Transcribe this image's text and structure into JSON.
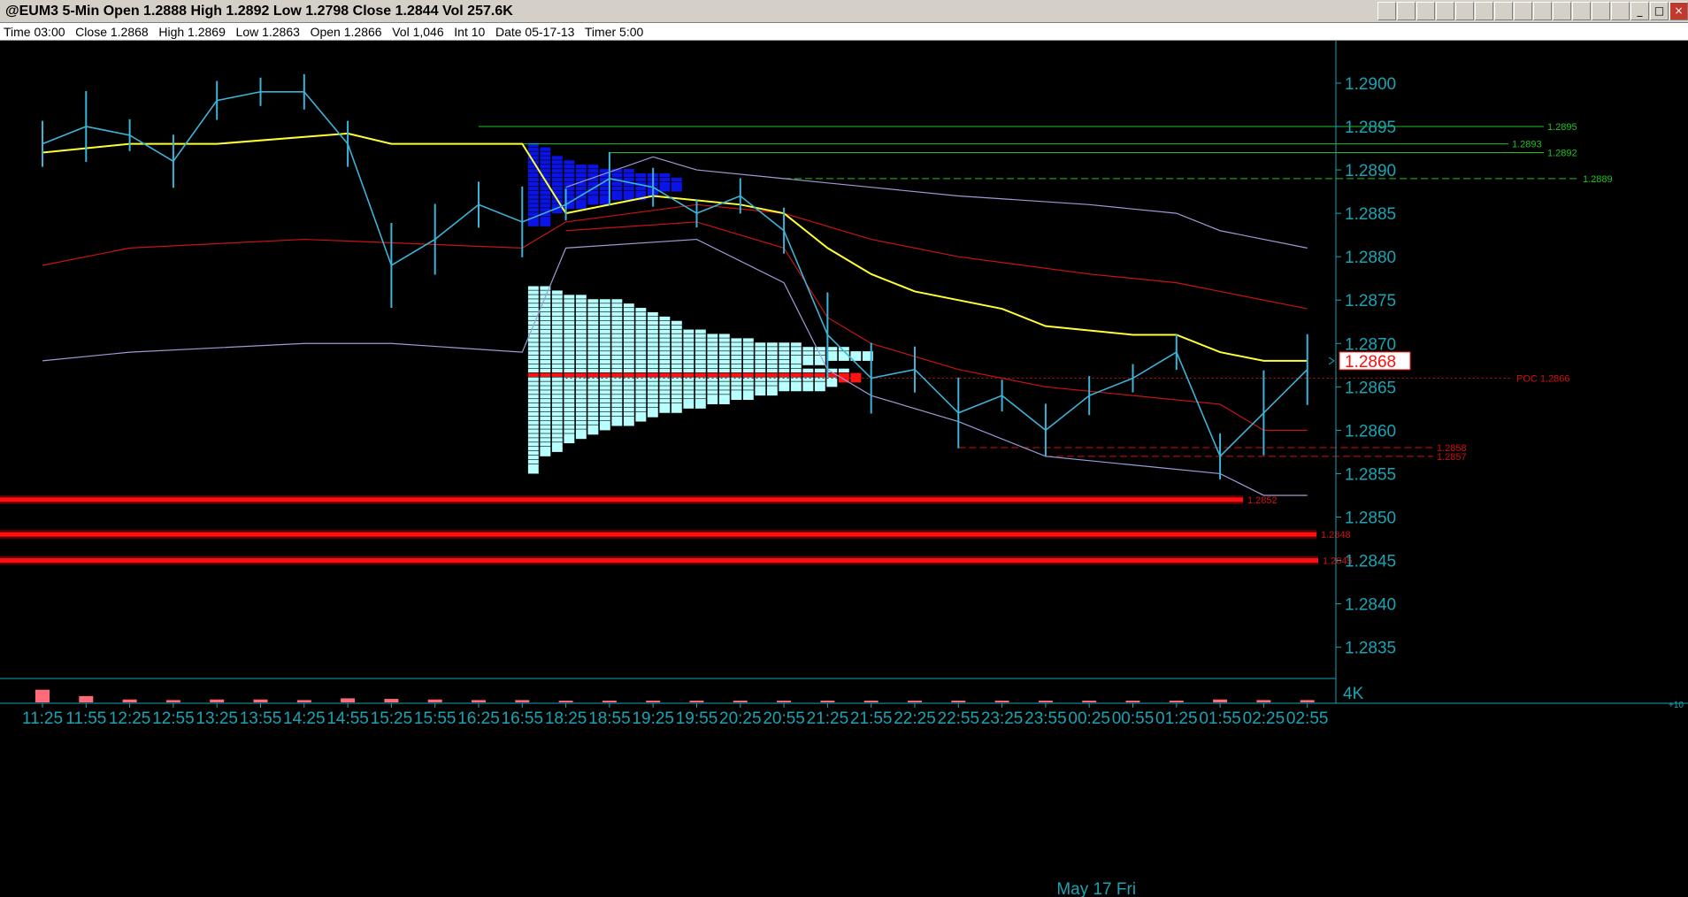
{
  "window": {
    "title": "@EUM3 5-Min Open 1.2888 High 1.2892 Low 1.2798 Close 1.2844 Vol 257.6K",
    "toolbar_icons": [
      "chart-icon",
      "draw-icon",
      "indicator-icon",
      "pencil-icon",
      "bar-icon",
      "color-icon",
      "clock-icon",
      "cursor-icon",
      "grid-icon",
      "line-icon",
      "arrow-down-icon",
      "trash-icon",
      "tools-icon",
      "minimize-icon",
      "maximize-icon",
      "close-icon"
    ]
  },
  "infobar": {
    "text": "Time 03:00   Close 1.2868   High 1.2869   Low 1.2863   Open 1.2866   Vol 1,046   Int 10   Date 05-17-13   Timer 5:00"
  },
  "chart_data": {
    "type": "line",
    "title": "@EUM3 5-Min",
    "y_ticks": [
      "1.2900",
      "1.2895",
      "1.2890",
      "1.2885",
      "1.2880",
      "1.2875",
      "1.2870",
      "1.2865",
      "1.2860",
      "1.2855",
      "1.2850",
      "1.2845",
      "1.2840",
      "1.2835"
    ],
    "ylim": [
      1.28315,
      1.29055
    ],
    "x_ticks": [
      "11:25",
      "11:55",
      "12:25",
      "12:55",
      "13:25",
      "13:55",
      "14:25",
      "14:55",
      "15:25",
      "15:55",
      "16:25",
      "16:55",
      "18:25",
      "18:55",
      "19:25",
      "19:55",
      "20:25",
      "20:55",
      "21:25",
      "21:55",
      "22:25",
      "22:55",
      "23:25",
      "23:55",
      "00:25",
      "00:55",
      "01:25",
      "01:55",
      "02:25",
      "02:55"
    ],
    "date_label": "May 17 Fri",
    "last_price": "1.2868",
    "volume_label": "4K",
    "volume_sublabel": "+10",
    "level_lines": [
      {
        "label": "1.2895",
        "value": 1.2895,
        "from": "16:25",
        "color": "#21c021",
        "style": "solid"
      },
      {
        "label": "1.2893",
        "value": 1.2893,
        "from": "16:55",
        "color": "#21c021",
        "style": "solid"
      },
      {
        "label": "1.2892",
        "value": 1.2892,
        "from": "18:55",
        "color": "#21c021",
        "style": "solid"
      },
      {
        "label": "1.2889",
        "value": 1.2889,
        "from": "20:55",
        "color": "#21c021",
        "style": "dashed"
      },
      {
        "label": "1.2858",
        "value": 1.2858,
        "from": "22:55",
        "color": "#d01010",
        "style": "dashed"
      },
      {
        "label": "1.2857",
        "value": 1.2857,
        "from": "23:55",
        "color": "#d01010",
        "style": "dashed"
      },
      {
        "label": "POC 1.2866",
        "value": 1.2866,
        "from": "18:25",
        "color": "#d01010",
        "style": "dotted"
      }
    ],
    "support_bands": [
      {
        "label": "1.2852",
        "value": 1.2852
      },
      {
        "label": "1.2848",
        "value": 1.2848
      },
      {
        "label": "1.2845",
        "value": 1.2845
      }
    ],
    "price_series": [
      {
        "t": "11:25",
        "v": 1.2893
      },
      {
        "t": "11:55",
        "v": 1.2895
      },
      {
        "t": "12:25",
        "v": 1.2894
      },
      {
        "t": "12:55",
        "v": 1.2891
      },
      {
        "t": "13:25",
        "v": 1.2898
      },
      {
        "t": "13:55",
        "v": 1.2899
      },
      {
        "t": "14:25",
        "v": 1.2899
      },
      {
        "t": "14:55",
        "v": 1.2893
      },
      {
        "t": "15:25",
        "v": 1.2879
      },
      {
        "t": "15:55",
        "v": 1.2882
      },
      {
        "t": "16:25",
        "v": 1.2886
      },
      {
        "t": "16:55",
        "v": 1.2884
      },
      {
        "t": "18:25",
        "v": 1.2886
      },
      {
        "t": "18:55",
        "v": 1.2889
      },
      {
        "t": "19:25",
        "v": 1.2888
      },
      {
        "t": "19:55",
        "v": 1.2885
      },
      {
        "t": "20:25",
        "v": 1.2887
      },
      {
        "t": "20:55",
        "v": 1.2883
      },
      {
        "t": "21:25",
        "v": 1.2871
      },
      {
        "t": "21:55",
        "v": 1.2866
      },
      {
        "t": "22:25",
        "v": 1.2867
      },
      {
        "t": "22:55",
        "v": 1.2862
      },
      {
        "t": "23:25",
        "v": 1.2864
      },
      {
        "t": "23:55",
        "v": 1.286
      },
      {
        "t": "00:25",
        "v": 1.2864
      },
      {
        "t": "00:55",
        "v": 1.2866
      },
      {
        "t": "01:25",
        "v": 1.2869
      },
      {
        "t": "01:55",
        "v": 1.2857
      },
      {
        "t": "02:25",
        "v": 1.2862
      },
      {
        "t": "02:55",
        "v": 1.2867
      }
    ],
    "vwap_series": [
      {
        "t": "11:25",
        "v": 1.2892
      },
      {
        "t": "12:25",
        "v": 1.2893
      },
      {
        "t": "13:25",
        "v": 1.2893
      },
      {
        "t": "14:55",
        "v": 1.28942
      },
      {
        "t": "15:25",
        "v": 1.2893
      },
      {
        "t": "16:55",
        "v": 1.2893
      },
      {
        "t": "18:25",
        "v": 1.2885
      },
      {
        "t": "19:25",
        "v": 1.2887
      },
      {
        "t": "20:25",
        "v": 1.2886
      },
      {
        "t": "20:55",
        "v": 1.2885
      },
      {
        "t": "21:25",
        "v": 1.2881
      },
      {
        "t": "21:55",
        "v": 1.2878
      },
      {
        "t": "22:25",
        "v": 1.2876
      },
      {
        "t": "23:25",
        "v": 1.2874
      },
      {
        "t": "23:55",
        "v": 1.2872
      },
      {
        "t": "00:55",
        "v": 1.2871
      },
      {
        "t": "01:25",
        "v": 1.2871
      },
      {
        "t": "01:55",
        "v": 1.2869
      },
      {
        "t": "02:25",
        "v": 1.2868
      },
      {
        "t": "02:55",
        "v": 1.2868
      }
    ],
    "upper_band_series": [
      {
        "t": "18:25",
        "v": 1.2888
      },
      {
        "t": "19:25",
        "v": 1.28915
      },
      {
        "t": "19:55",
        "v": 1.289
      },
      {
        "t": "20:55",
        "v": 1.2889
      },
      {
        "t": "21:55",
        "v": 1.2888
      },
      {
        "t": "22:55",
        "v": 1.2887
      },
      {
        "t": "00:25",
        "v": 1.2886
      },
      {
        "t": "01:25",
        "v": 1.2885
      },
      {
        "t": "01:55",
        "v": 1.2883
      },
      {
        "t": "02:55",
        "v": 1.2881
      }
    ],
    "lower_band_series": [
      {
        "t": "11:25",
        "v": 1.2868
      },
      {
        "t": "12:25",
        "v": 1.2869
      },
      {
        "t": "14:25",
        "v": 1.287
      },
      {
        "t": "15:25",
        "v": 1.287
      },
      {
        "t": "16:55",
        "v": 1.2869
      },
      {
        "t": "18:25",
        "v": 1.2881
      },
      {
        "t": "19:55",
        "v": 1.2882
      },
      {
        "t": "20:55",
        "v": 1.2877
      },
      {
        "t": "21:25",
        "v": 1.2867
      },
      {
        "t": "21:55",
        "v": 1.2864
      },
      {
        "t": "22:55",
        "v": 1.2861
      },
      {
        "t": "23:55",
        "v": 1.2857
      },
      {
        "t": "00:55",
        "v": 1.2856
      },
      {
        "t": "01:55",
        "v": 1.2855
      },
      {
        "t": "02:25",
        "v": 1.28525
      },
      {
        "t": "02:55",
        "v": 1.28525
      }
    ],
    "red_mid_upper_series": [
      {
        "t": "11:25",
        "v": 1.2879
      },
      {
        "t": "12:25",
        "v": 1.2881
      },
      {
        "t": "14:25",
        "v": 1.2882
      },
      {
        "t": "16:55",
        "v": 1.2881
      },
      {
        "t": "18:25",
        "v": 1.2884
      },
      {
        "t": "19:55",
        "v": 1.2886
      },
      {
        "t": "20:55",
        "v": 1.2885
      },
      {
        "t": "21:55",
        "v": 1.2882
      },
      {
        "t": "22:55",
        "v": 1.288
      },
      {
        "t": "00:25",
        "v": 1.2878
      },
      {
        "t": "01:25",
        "v": 1.2877
      },
      {
        "t": "01:55",
        "v": 1.2876
      },
      {
        "t": "02:55",
        "v": 1.2874
      }
    ],
    "red_mid_lower_series": [
      {
        "t": "18:25",
        "v": 1.2883
      },
      {
        "t": "19:55",
        "v": 1.2884
      },
      {
        "t": "20:55",
        "v": 1.2881
      },
      {
        "t": "21:25",
        "v": 1.2873
      },
      {
        "t": "21:55",
        "v": 1.287
      },
      {
        "t": "22:55",
        "v": 1.2867
      },
      {
        "t": "23:55",
        "v": 1.2865
      },
      {
        "t": "00:55",
        "v": 1.2864
      },
      {
        "t": "01:55",
        "v": 1.2863
      },
      {
        "t": "02:25",
        "v": 1.286
      },
      {
        "t": "02:55",
        "v": 1.286
      }
    ],
    "profile_rows": [
      {
        "price": 1.28925,
        "count": 1,
        "kind": "va"
      },
      {
        "price": 1.2892,
        "count": 2,
        "kind": "va"
      },
      {
        "price": 1.28915,
        "count": 2,
        "kind": "va"
      },
      {
        "price": 1.2891,
        "count": 3,
        "kind": "va"
      },
      {
        "price": 1.28905,
        "count": 4,
        "kind": "va"
      },
      {
        "price": 1.289,
        "count": 6,
        "kind": "va"
      },
      {
        "price": 1.28895,
        "count": 9,
        "kind": "va"
      },
      {
        "price": 1.2889,
        "count": 12,
        "kind": "va"
      },
      {
        "price": 1.28885,
        "count": 13,
        "kind": "va"
      },
      {
        "price": 1.2888,
        "count": 13,
        "kind": "va"
      },
      {
        "price": 1.28875,
        "count": 11,
        "kind": "va"
      },
      {
        "price": 1.2887,
        "count": 10,
        "kind": "va"
      },
      {
        "price": 1.28865,
        "count": 7,
        "kind": "va"
      },
      {
        "price": 1.2886,
        "count": 5,
        "kind": "va"
      },
      {
        "price": 1.28855,
        "count": 3,
        "kind": "va"
      },
      {
        "price": 1.2885,
        "count": 2,
        "kind": "va"
      },
      {
        "price": 1.28845,
        "count": 2,
        "kind": "va"
      },
      {
        "price": 1.2884,
        "count": 2,
        "kind": "va"
      },
      {
        "price": 1.2876,
        "count": 2,
        "kind": "out"
      },
      {
        "price": 1.28755,
        "count": 3,
        "kind": "out"
      },
      {
        "price": 1.2875,
        "count": 5,
        "kind": "out"
      },
      {
        "price": 1.28745,
        "count": 8,
        "kind": "out"
      },
      {
        "price": 1.2874,
        "count": 9,
        "kind": "out"
      },
      {
        "price": 1.28735,
        "count": 10,
        "kind": "out"
      },
      {
        "price": 1.2873,
        "count": 11,
        "kind": "out"
      },
      {
        "price": 1.28725,
        "count": 12,
        "kind": "out"
      },
      {
        "price": 1.2872,
        "count": 13,
        "kind": "out"
      },
      {
        "price": 1.28715,
        "count": 13,
        "kind": "out"
      },
      {
        "price": 1.2871,
        "count": 15,
        "kind": "out"
      },
      {
        "price": 1.28705,
        "count": 17,
        "kind": "out"
      },
      {
        "price": 1.287,
        "count": 19,
        "kind": "out"
      },
      {
        "price": 1.28695,
        "count": 23,
        "kind": "out"
      },
      {
        "price": 1.2869,
        "count": 27,
        "kind": "out"
      },
      {
        "price": 1.28685,
        "count": 29,
        "kind": "out"
      },
      {
        "price": 1.2868,
        "count": 25,
        "kind": "out"
      },
      {
        "price": 1.28675,
        "count": 22,
        "kind": "out"
      },
      {
        "price": 1.2867,
        "count": 23,
        "kind": "out"
      },
      {
        "price": 1.28665,
        "count": 27,
        "kind": "out"
      },
      {
        "price": 1.2866,
        "count": 28,
        "kind": "poc"
      },
      {
        "price": 1.28655,
        "count": 26,
        "kind": "out"
      },
      {
        "price": 1.2865,
        "count": 25,
        "kind": "out"
      },
      {
        "price": 1.28645,
        "count": 21,
        "kind": "out"
      },
      {
        "price": 1.2864,
        "count": 19,
        "kind": "out"
      },
      {
        "price": 1.28635,
        "count": 17,
        "kind": "out"
      },
      {
        "price": 1.2863,
        "count": 15,
        "kind": "out"
      },
      {
        "price": 1.28625,
        "count": 13,
        "kind": "out"
      },
      {
        "price": 1.2862,
        "count": 11,
        "kind": "out"
      },
      {
        "price": 1.28615,
        "count": 10,
        "kind": "out"
      },
      {
        "price": 1.2861,
        "count": 9,
        "kind": "out"
      },
      {
        "price": 1.28605,
        "count": 7,
        "kind": "out"
      },
      {
        "price": 1.286,
        "count": 6,
        "kind": "out"
      },
      {
        "price": 1.28595,
        "count": 5,
        "kind": "out"
      },
      {
        "price": 1.2859,
        "count": 4,
        "kind": "out"
      },
      {
        "price": 1.28585,
        "count": 3,
        "kind": "out"
      },
      {
        "price": 1.2858,
        "count": 3,
        "kind": "out"
      },
      {
        "price": 1.28575,
        "count": 2,
        "kind": "out"
      },
      {
        "price": 1.2857,
        "count": 1,
        "kind": "out"
      },
      {
        "price": 1.28565,
        "count": 1,
        "kind": "out"
      },
      {
        "price": 1.2856,
        "count": 1,
        "kind": "out"
      },
      {
        "price": 1.28555,
        "count": 1,
        "kind": "out"
      }
    ],
    "volume_bars": [
      {
        "t": "11:25",
        "v": 2.2
      },
      {
        "t": "11:55",
        "v": 1.1
      },
      {
        "t": "12:25",
        "v": 0.5
      },
      {
        "t": "12:55",
        "v": 0.4
      },
      {
        "t": "13:25",
        "v": 0.5
      },
      {
        "t": "13:55",
        "v": 0.5
      },
      {
        "t": "14:25",
        "v": 0.4
      },
      {
        "t": "14:55",
        "v": 0.7
      },
      {
        "t": "15:25",
        "v": 0.6
      },
      {
        "t": "15:55",
        "v": 0.5
      },
      {
        "t": "16:25",
        "v": 0.4
      },
      {
        "t": "16:55",
        "v": 0.4
      },
      {
        "t": "18:25",
        "v": 0.3
      },
      {
        "t": "18:55",
        "v": 0.3
      },
      {
        "t": "19:25",
        "v": 0.3
      },
      {
        "t": "19:55",
        "v": 0.3
      },
      {
        "t": "20:25",
        "v": 0.3
      },
      {
        "t": "20:55",
        "v": 0.3
      },
      {
        "t": "21:25",
        "v": 0.3
      },
      {
        "t": "21:55",
        "v": 0.3
      },
      {
        "t": "22:25",
        "v": 0.3
      },
      {
        "t": "22:55",
        "v": 0.3
      },
      {
        "t": "23:25",
        "v": 0.3
      },
      {
        "t": "23:55",
        "v": 0.3
      },
      {
        "t": "00:25",
        "v": 0.3
      },
      {
        "t": "00:55",
        "v": 0.3
      },
      {
        "t": "01:25",
        "v": 0.3
      },
      {
        "t": "01:55",
        "v": 0.5
      },
      {
        "t": "02:25",
        "v": 0.4
      },
      {
        "t": "02:55",
        "v": 0.4
      }
    ],
    "colors": {
      "background": "#000000",
      "axis": "#19a3b3",
      "price": "#3cb4d8",
      "vwap": "#ffff33",
      "band": "#9c9cd8",
      "red_band": "#c81414",
      "level_green": "#21c021",
      "level_red": "#d01010",
      "profile_va": "#0a14e6",
      "profile_out": "#b8ffff",
      "profile_poc": "#ff1414",
      "volume": "#ff6b7a",
      "last_price_bg": "#ff1010"
    }
  }
}
